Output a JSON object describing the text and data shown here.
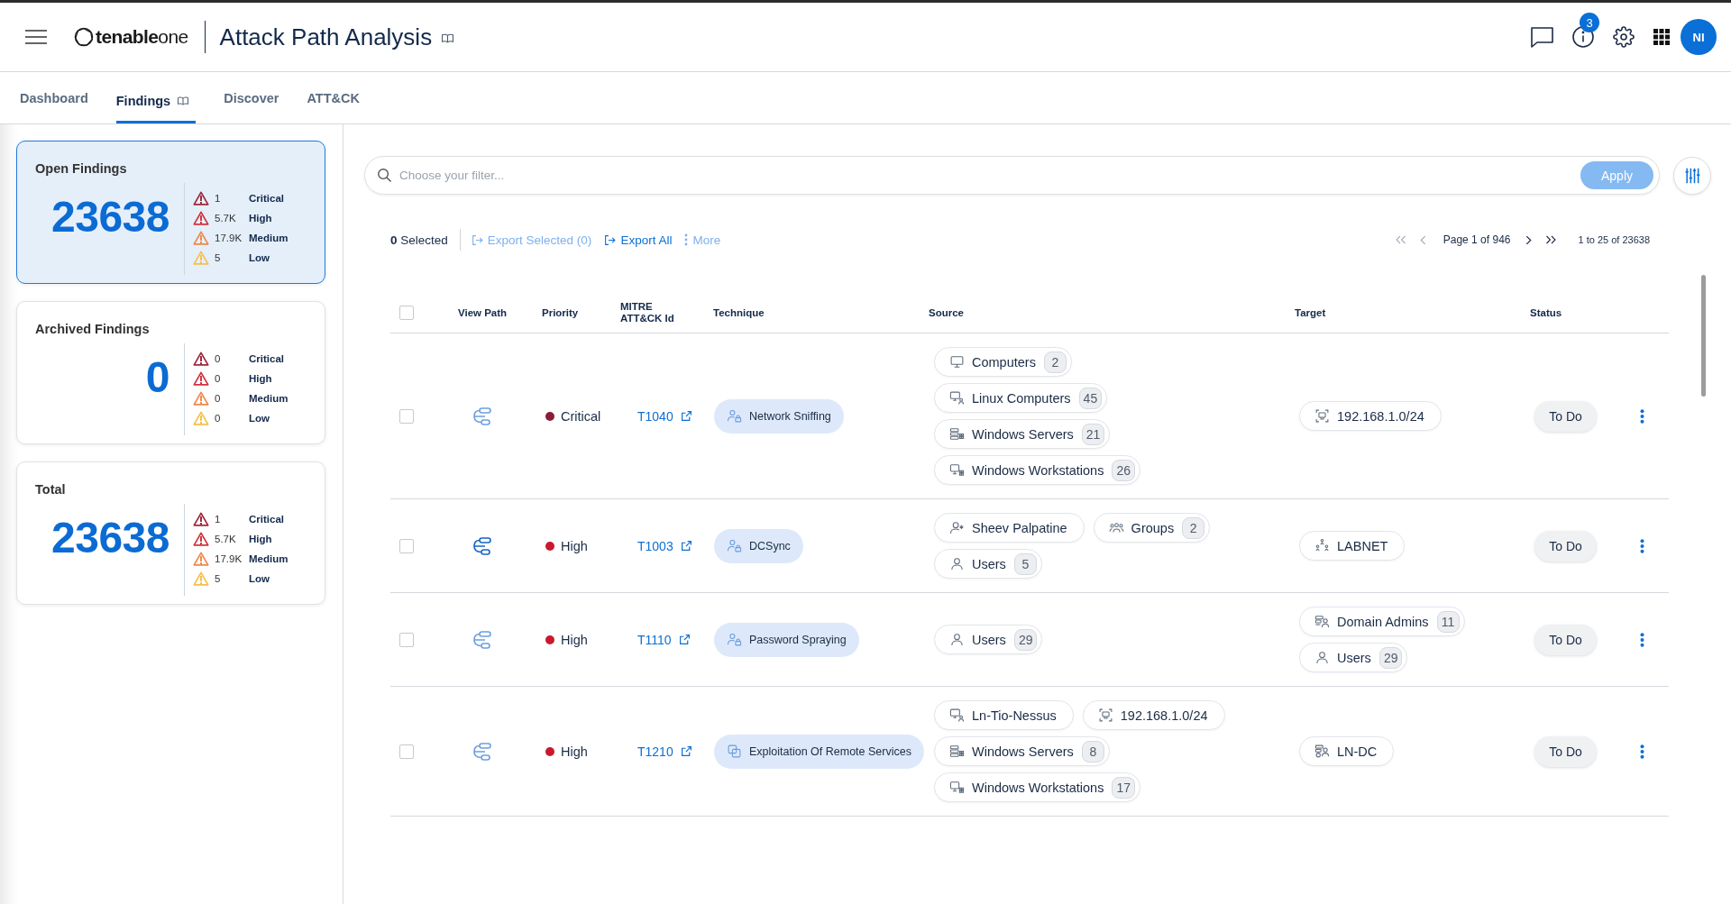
{
  "header": {
    "logo": "**tenable**one",
    "title": "Attack Path Analysis",
    "notifications": "3",
    "avatar": "NI"
  },
  "tabs": [
    {
      "label": "Dashboard",
      "selected": false,
      "guide_icon": false
    },
    {
      "label": "Findings",
      "selected": true,
      "guide_icon": true
    },
    {
      "label": "Discover",
      "selected": false,
      "guide_icon": false
    },
    {
      "label": "ATT&CK",
      "selected": false,
      "guide_icon": false
    }
  ],
  "summary_cards": [
    {
      "title": "Open Findings",
      "total": "23638",
      "selected": true,
      "severities": [
        {
          "count": "1",
          "label": "Critical",
          "color": "#9e2a3f"
        },
        {
          "count": "5.7K",
          "label": "High",
          "color": "#d2343f"
        },
        {
          "count": "17.9K",
          "label": "Medium",
          "color": "#f08a4b"
        },
        {
          "count": "5",
          "label": "Low",
          "color": "#f6c04f"
        }
      ]
    },
    {
      "title": "Archived Findings",
      "total": "0",
      "selected": false,
      "severities": [
        {
          "count": "0",
          "label": "Critical",
          "color": "#9e2a3f"
        },
        {
          "count": "0",
          "label": "High",
          "color": "#d2343f"
        },
        {
          "count": "0",
          "label": "Medium",
          "color": "#f08a4b"
        },
        {
          "count": "0",
          "label": "Low",
          "color": "#f6c04f"
        }
      ]
    },
    {
      "title": "Total",
      "total": "23638",
      "selected": false,
      "severities": [
        {
          "count": "1",
          "label": "Critical",
          "color": "#9e2a3f"
        },
        {
          "count": "5.7K",
          "label": "High",
          "color": "#d2343f"
        },
        {
          "count": "17.9K",
          "label": "Medium",
          "color": "#f08a4b"
        },
        {
          "count": "5",
          "label": "Low",
          "color": "#f6c04f"
        }
      ]
    }
  ],
  "filter": {
    "placeholder": "Choose your filter...",
    "apply": {
      "label": "Apply",
      "disabled": true
    }
  },
  "toolbar": {
    "selected": "**0** Selected",
    "export_selected": {
      "label": "Export Selected (0)",
      "disabled": true
    },
    "export_all": {
      "label": "Export All",
      "disabled": false
    },
    "more": {
      "label": "More",
      "disabled": true
    }
  },
  "pagination": {
    "first": {
      "disabled": true
    },
    "previous": {
      "disabled": true
    },
    "page": "Page 1 of 946",
    "next": {
      "disabled": false
    },
    "last": {
      "disabled": false
    },
    "range": "1 to 25 of 23638"
  },
  "table": {
    "columns": [
      "View Path",
      "Priority",
      "MITRE ATT&CK Id",
      "Technique",
      "Source",
      "Target",
      "Status"
    ],
    "all_checked": false,
    "rows": [
      {
        "checked": false,
        "path_active": false,
        "priority": {
          "label": "Critical",
          "color": "#8c1c36"
        },
        "mitre_id": "T1040",
        "technique": {
          "label": "Network Sniffing",
          "kind": "user-lock"
        },
        "source": [
          {
            "label": "Computers",
            "count": "2",
            "kind": "computer"
          },
          {
            "label": "Linux Computers",
            "count": "45",
            "kind": "linux"
          },
          {
            "label": "Windows Servers",
            "count": "21",
            "kind": "server"
          },
          {
            "label": "Windows Workstations",
            "count": "26",
            "kind": "workstation"
          }
        ],
        "target": [
          {
            "label": "192.168.1.0/24",
            "kind": "network"
          }
        ],
        "status": "To Do"
      },
      {
        "checked": false,
        "path_active": true,
        "priority": {
          "label": "High",
          "color": "#c8192e"
        },
        "mitre_id": "T1003",
        "technique": {
          "label": "DCSync",
          "kind": "user-lock"
        },
        "source": [
          {
            "label": "Sheev Palpatine",
            "kind": "user-star"
          },
          {
            "label": "Groups",
            "count": "2",
            "kind": "group"
          },
          {
            "label": "Users",
            "count": "5",
            "kind": "user"
          }
        ],
        "target": [
          {
            "label": "LABNET",
            "kind": "domain"
          }
        ],
        "status": "To Do"
      },
      {
        "checked": false,
        "path_active": false,
        "priority": {
          "label": "High",
          "color": "#c8192e"
        },
        "mitre_id": "T1110",
        "technique": {
          "label": "Password Spraying",
          "kind": "user-lock"
        },
        "source": [
          {
            "label": "Users",
            "count": "29",
            "kind": "user"
          }
        ],
        "target": [
          {
            "label": "Domain Admins",
            "count": "11",
            "kind": "admin-group"
          },
          {
            "label": "Users",
            "count": "29",
            "kind": "user"
          }
        ],
        "status": "To Do"
      },
      {
        "checked": false,
        "path_active": false,
        "priority": {
          "label": "High",
          "color": "#c8192e"
        },
        "mitre_id": "T1210",
        "technique": {
          "label": "Exploitation Of Remote Services",
          "kind": "copy"
        },
        "source": [
          {
            "label": "Ln-Tio-Nessus",
            "kind": "linux"
          },
          {
            "label": "192.168.1.0/24",
            "kind": "network"
          },
          {
            "label": "Windows Servers",
            "count": "8",
            "kind": "server"
          },
          {
            "label": "Windows Workstations",
            "count": "17",
            "kind": "workstation"
          }
        ],
        "target": [
          {
            "label": "LN-DC",
            "kind": "domain-controller"
          }
        ],
        "status": "To Do"
      }
    ]
  }
}
